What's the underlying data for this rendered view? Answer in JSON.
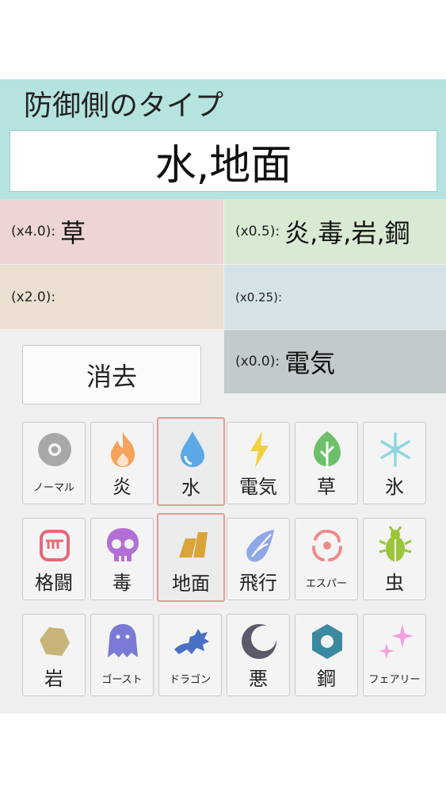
{
  "defense": {
    "title": "防御側のタイプ",
    "value": "水,地面"
  },
  "effectiveness": {
    "x4": {
      "label": "(x4.0):",
      "types": "草"
    },
    "x05": {
      "label": "(x0.5):",
      "types": "炎,毒,岩,鋼"
    },
    "x2": {
      "label": "(x2.0):",
      "types": ""
    },
    "x025": {
      "label": "(x0.25):",
      "types": ""
    },
    "x0": {
      "label": "(x0.0):",
      "types": "電気"
    }
  },
  "clear_label": "消去",
  "types": [
    {
      "name": "ノーマル",
      "icon": "normal-icon",
      "color": "#a8a8a8",
      "selected": false
    },
    {
      "name": "炎",
      "icon": "fire-icon",
      "color": "#f5a25a",
      "selected": false
    },
    {
      "name": "水",
      "icon": "water-icon",
      "color": "#5aa9e6",
      "selected": true
    },
    {
      "name": "電気",
      "icon": "electric-icon",
      "color": "#f2d13c",
      "selected": false
    },
    {
      "name": "草",
      "icon": "grass-icon",
      "color": "#6dbf6a",
      "selected": false
    },
    {
      "name": "氷",
      "icon": "ice-icon",
      "color": "#8fd6e0",
      "selected": false
    },
    {
      "name": "格闘",
      "icon": "fighting-icon",
      "color": "#e26a7a",
      "selected": false
    },
    {
      "name": "毒",
      "icon": "poison-icon",
      "color": "#b36fd6",
      "selected": false
    },
    {
      "name": "地面",
      "icon": "ground-icon",
      "color": "#d9a53a",
      "selected": true
    },
    {
      "name": "飛行",
      "icon": "flying-icon",
      "color": "#8ea8e6",
      "selected": false
    },
    {
      "name": "エスパー",
      "icon": "psychic-icon",
      "color": "#f08a8a",
      "selected": false
    },
    {
      "name": "虫",
      "icon": "bug-icon",
      "color": "#9cc63a",
      "selected": false
    },
    {
      "name": "岩",
      "icon": "rock-icon",
      "color": "#c8b47a",
      "selected": false
    },
    {
      "name": "ゴースト",
      "icon": "ghost-icon",
      "color": "#7a7ad6",
      "selected": false
    },
    {
      "name": "ドラゴン",
      "icon": "dragon-icon",
      "color": "#4a70c6",
      "selected": false
    },
    {
      "name": "悪",
      "icon": "dark-icon",
      "color": "#5a5a6a",
      "selected": false
    },
    {
      "name": "鋼",
      "icon": "steel-icon",
      "color": "#3a8aa0",
      "selected": false
    },
    {
      "name": "フェアリー",
      "icon": "fairy-icon",
      "color": "#f0a0e0",
      "selected": false
    }
  ]
}
